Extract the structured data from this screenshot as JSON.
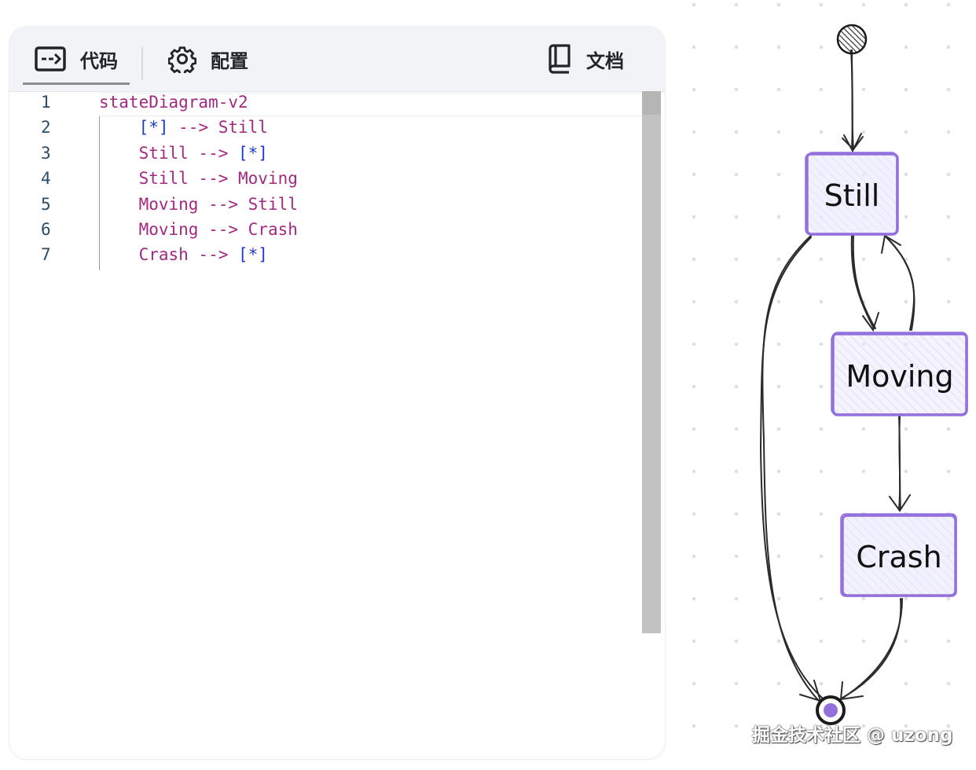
{
  "tabs": {
    "code": {
      "label": "代码",
      "icon": "code-arrow-icon"
    },
    "config": {
      "label": "配置",
      "icon": "gear-icon"
    },
    "docs": {
      "label": "文档",
      "icon": "book-icon"
    }
  },
  "editor": {
    "line_numbers": [
      "1",
      "2",
      "3",
      "4",
      "5",
      "6",
      "7"
    ],
    "lines": [
      {
        "indent": "",
        "parts": [
          {
            "t": "stateDiagram-v2",
            "c": "kw"
          }
        ]
      },
      {
        "indent": "    ",
        "parts": [
          {
            "t": "[*]",
            "c": "br"
          },
          {
            "t": " --> Still",
            "c": "ar"
          }
        ]
      },
      {
        "indent": "    ",
        "parts": [
          {
            "t": "Still --> ",
            "c": "ar"
          },
          {
            "t": "[*]",
            "c": "br"
          }
        ]
      },
      {
        "indent": "    ",
        "parts": [
          {
            "t": "Still --> Moving",
            "c": "ar"
          }
        ]
      },
      {
        "indent": "    ",
        "parts": [
          {
            "t": "Moving --> Still",
            "c": "ar"
          }
        ]
      },
      {
        "indent": "    ",
        "parts": [
          {
            "t": "Moving --> Crash",
            "c": "ar"
          }
        ]
      },
      {
        "indent": "    ",
        "parts": [
          {
            "t": "Crash --> ",
            "c": "ar"
          },
          {
            "t": "[*]",
            "c": "br"
          }
        ]
      }
    ]
  },
  "diagram": {
    "states": [
      "Still",
      "Moving",
      "Crash"
    ],
    "node_fill": "#ecebfd",
    "node_stroke": "#9370db",
    "end_dot_color": "#9370db"
  },
  "watermark": "掘金技术社区 @ uzong"
}
